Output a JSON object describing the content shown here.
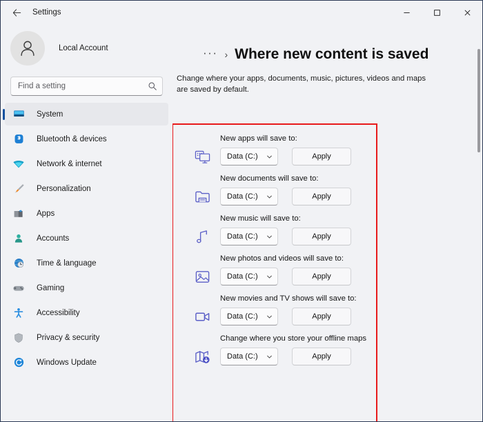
{
  "window": {
    "title": "Settings",
    "back_icon": "back-arrow-icon",
    "controls": {
      "minimize": "–",
      "maximize": "□",
      "close": "✕"
    }
  },
  "sidebar": {
    "account_name": "Local Account",
    "search": {
      "placeholder": "Find a setting",
      "value": "",
      "icon": "search-icon"
    },
    "items": [
      {
        "label": "System",
        "icon": "monitor-icon",
        "active": true
      },
      {
        "label": "Bluetooth & devices",
        "icon": "bluetooth-icon",
        "active": false
      },
      {
        "label": "Network & internet",
        "icon": "wifi-icon",
        "active": false
      },
      {
        "label": "Personalization",
        "icon": "paintbrush-icon",
        "active": false
      },
      {
        "label": "Apps",
        "icon": "apps-icon",
        "active": false
      },
      {
        "label": "Accounts",
        "icon": "person-icon",
        "active": false
      },
      {
        "label": "Time & language",
        "icon": "clock-globe-icon",
        "active": false
      },
      {
        "label": "Gaming",
        "icon": "gamepad-icon",
        "active": false
      },
      {
        "label": "Accessibility",
        "icon": "accessibility-icon",
        "active": false
      },
      {
        "label": "Privacy & security",
        "icon": "shield-icon",
        "active": false
      },
      {
        "label": "Windows Update",
        "icon": "update-icon",
        "active": false
      }
    ]
  },
  "main": {
    "breadcrumb_dots": "···",
    "breadcrumb_separator": "›",
    "title": "Where new content is saved",
    "description": "Change where your apps, documents, music, pictures, videos and maps are saved by default.",
    "highlight_color": "#e8191a",
    "accent_color": "#0f4f9e",
    "settings": [
      {
        "label": "New apps will save to:",
        "icon": "app-window-icon",
        "drive": "Data (C:)",
        "apply_label": "Apply"
      },
      {
        "label": "New documents will save to:",
        "icon": "document-folder-icon",
        "drive": "Data (C:)",
        "apply_label": "Apply"
      },
      {
        "label": "New music will save to:",
        "icon": "music-note-icon",
        "drive": "Data (C:)",
        "apply_label": "Apply"
      },
      {
        "label": "New photos and videos will save to:",
        "icon": "photo-icon",
        "drive": "Data (C:)",
        "apply_label": "Apply"
      },
      {
        "label": "New movies and TV shows will save to:",
        "icon": "video-camera-icon",
        "drive": "Data (C:)",
        "apply_label": "Apply"
      },
      {
        "label": "Change where you store your offline maps",
        "icon": "map-download-icon",
        "drive": "Data (C:)",
        "apply_label": "Apply"
      }
    ]
  }
}
